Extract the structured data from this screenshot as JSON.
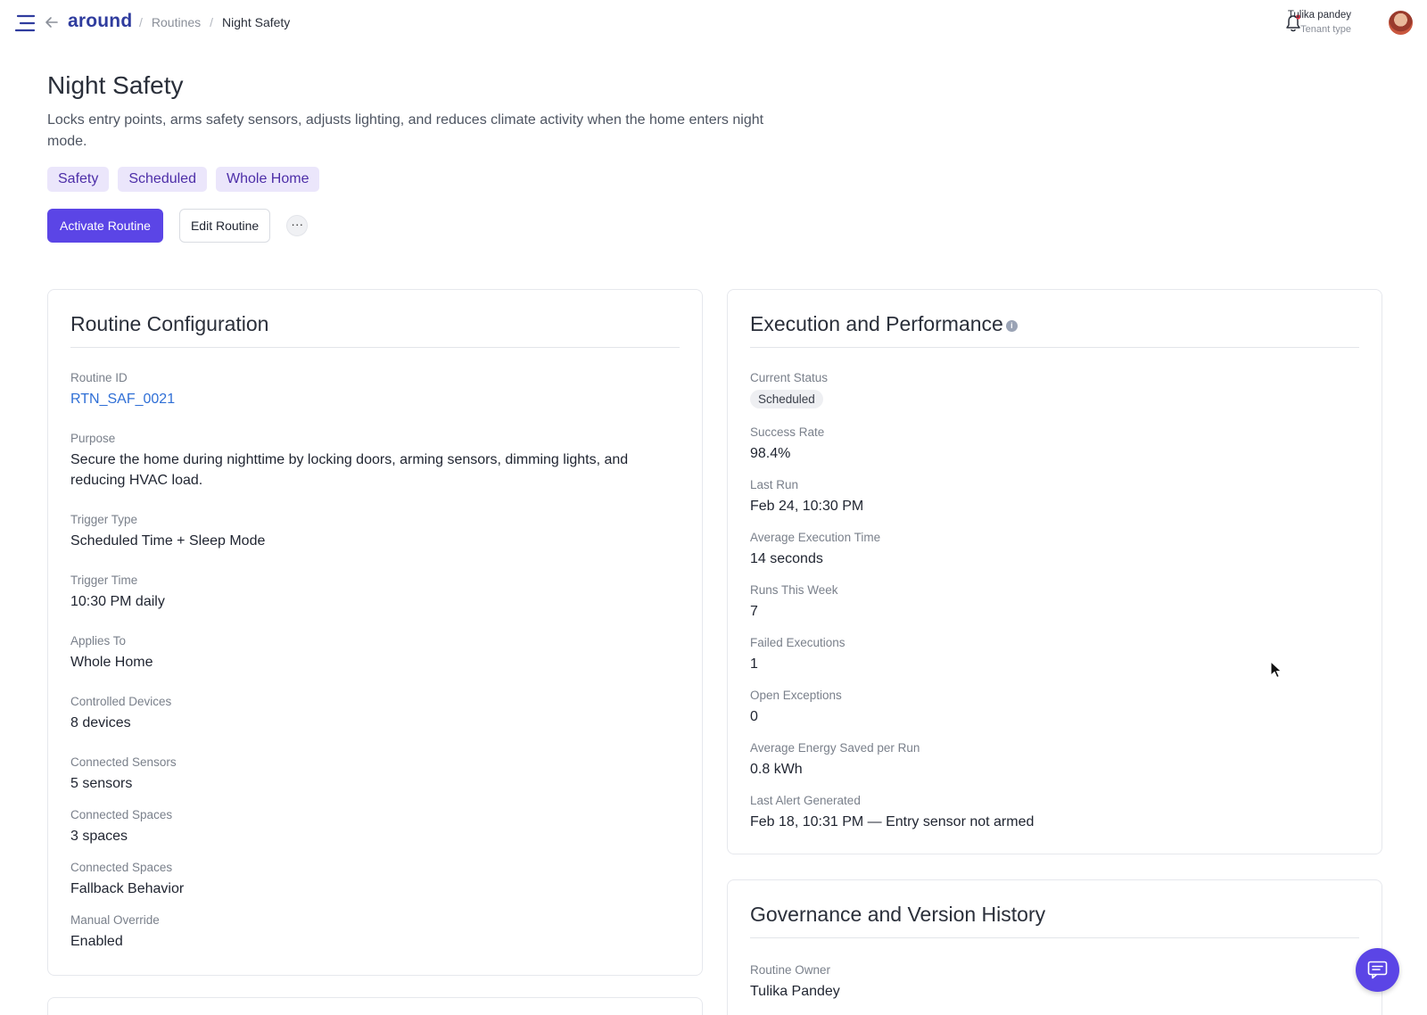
{
  "app": {
    "logo": "around",
    "breadcrumb": [
      "Routines",
      "Night Safety"
    ],
    "user": {
      "name": "Tulika pandey",
      "role": "Tenant type"
    }
  },
  "header": {
    "title": "Night Safety",
    "description": "Locks entry points, arms safety sensors, adjusts lighting, and reduces climate activity when the home enters night mode.",
    "tags": [
      "Safety",
      "Scheduled",
      "Whole Home"
    ],
    "activate_label": "Activate Routine",
    "edit_label": "Edit Routine",
    "more_label": "···"
  },
  "configuration": {
    "title": "Routine Configuration",
    "fields": [
      {
        "label": "Routine ID",
        "value": "RTN_SAF_0021"
      },
      {
        "label": "Purpose",
        "value": "Secure the home during nighttime by locking doors, arming sensors, dimming lights, and reducing HVAC load."
      },
      {
        "label": "Trigger Type",
        "value": "Scheduled Time + Sleep Mode"
      },
      {
        "label": "Trigger Time",
        "value": "10:30 PM daily"
      },
      {
        "label": "Applies To",
        "value": "Whole Home"
      },
      {
        "label": "Controlled Devices",
        "value": "8 devices"
      },
      {
        "label": "Connected Sensors",
        "value": "5 sensors"
      },
      {
        "label": "Connected Spaces",
        "value": "3 spaces"
      },
      {
        "label": "Connected Spaces",
        "value": "Fallback Behavior"
      },
      {
        "label": "Manual Override",
        "value": "Enabled"
      }
    ]
  },
  "execution": {
    "title": "Execution and Performance",
    "status_label": "Current Status",
    "status_value": "Scheduled",
    "fields": [
      {
        "label": "Success Rate",
        "value": "98.4%"
      },
      {
        "label": "Last Run",
        "value": "Feb 24, 10:30 PM"
      },
      {
        "label": "Average Execution Time",
        "value": "14 seconds"
      },
      {
        "label": "Runs This Week",
        "value": "7"
      },
      {
        "label": "Failed Executions",
        "value": "1"
      },
      {
        "label": "Open Exceptions",
        "value": "0"
      },
      {
        "label": "Average Energy Saved per Run",
        "value": "0.8 kWh"
      },
      {
        "label": "Last Alert Generated",
        "value": "Feb 18, 10:31 PM — Entry sensor not armed"
      }
    ]
  },
  "governance": {
    "title": "Governance and Version History",
    "fields": [
      {
        "label": "Routine Owner",
        "value": "Tulika Pandey"
      }
    ]
  },
  "colors": {
    "accent": "#5b45e6",
    "tag_bg": "#ebe6fb",
    "tag_text": "#4d2ea8",
    "link": "#2f6fd6",
    "logo": "#2f3c9e"
  },
  "icons": [
    "menu-icon",
    "back-arrow-icon",
    "bell-icon",
    "info-icon",
    "more-icon",
    "chat-icon"
  ]
}
